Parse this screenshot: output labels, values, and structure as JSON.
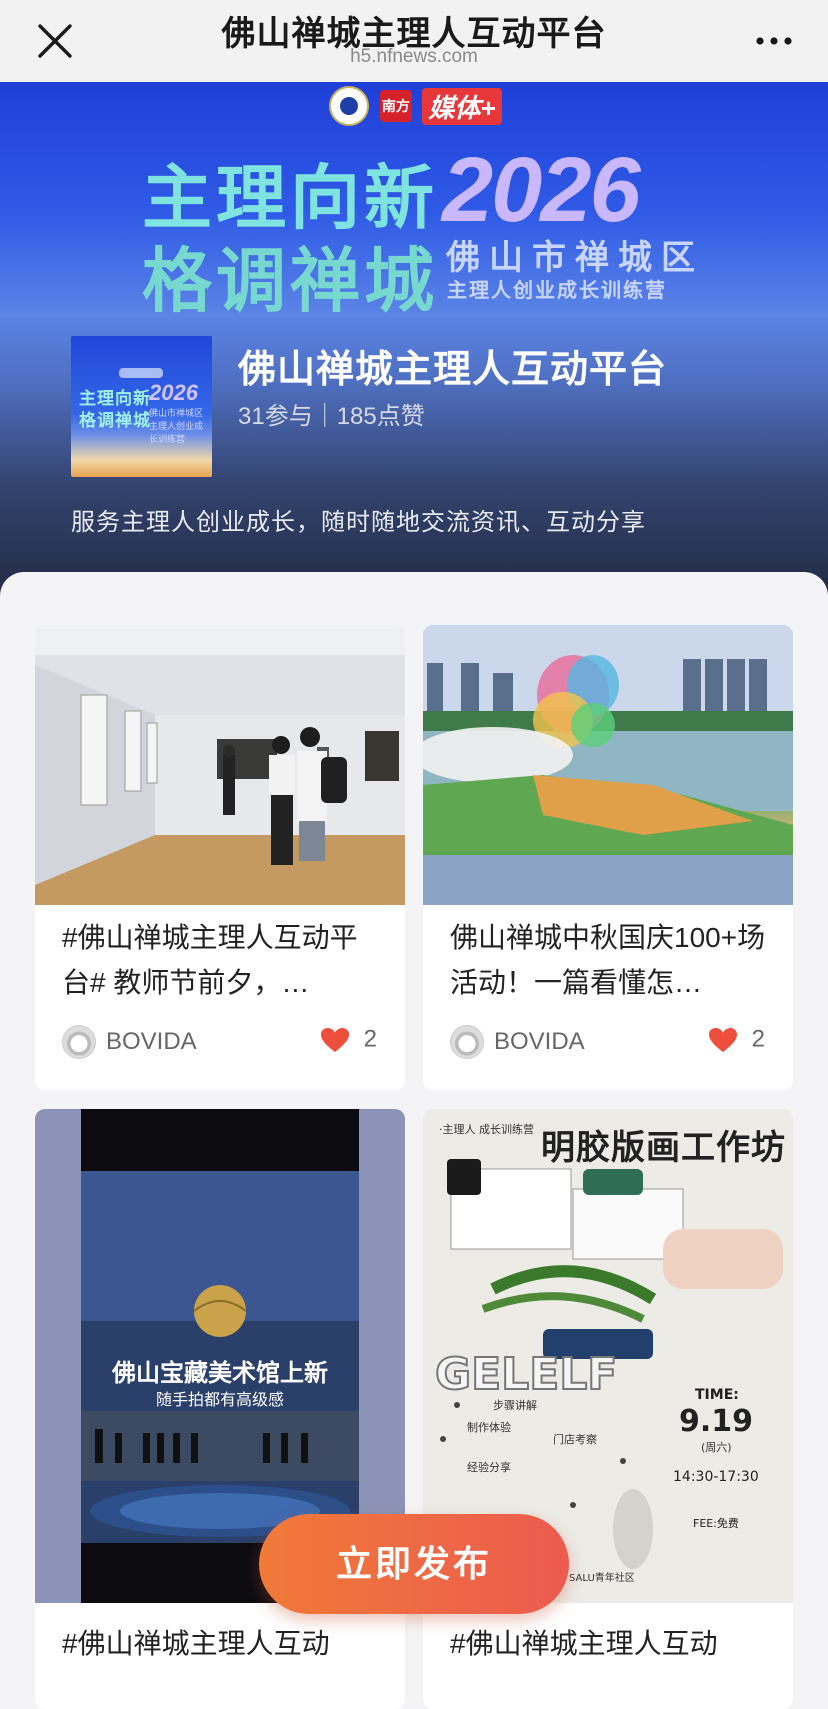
{
  "nav": {
    "title": "佛山禅城主理人互动平台",
    "url": "h5.nfnews.com"
  },
  "hero": {
    "logo_text": "媒体+",
    "logo_red": "南方",
    "slogan_line1": "主理向新",
    "slogan_line2": "格调禅城",
    "year": "2026",
    "camp_line1": "佛山市禅城区",
    "camp_line2": "主理人创业成长训练营",
    "cover": {
      "line1": "主理向新",
      "line2": "格调禅城",
      "year": "2026",
      "caption": "佛山市禅城区 主理人创业成长训练营"
    },
    "title": "佛山禅城主理人互动平台",
    "stats": "31参与｜185点赞",
    "description": "服务主理人创业成长，随时随地交流资讯、互动分享"
  },
  "feed": {
    "cards": [
      {
        "title": "#佛山禅城主理人互动平台# 教师节前夕，…",
        "author": "BOVIDA",
        "likes": "2",
        "image": "gallery-photo"
      },
      {
        "title": "佛山禅城中秋国庆100+场活动！一篇看懂怎…",
        "author": "BOVIDA",
        "likes": "2",
        "image": "dragon-boat-photo"
      },
      {
        "title": "#佛山禅城主理人互动",
        "image": "museum-photo",
        "overlay_line1": "佛山宝藏美术馆上新",
        "overlay_line2": "随手拍都有高级感"
      },
      {
        "title": "#佛山禅城主理人互动",
        "image": "workshop-poster",
        "poster": {
          "tag": "·主理人 成长训练营",
          "headline": "明胶版画工作坊",
          "brand": "GELELF",
          "time_label": "TIME:",
          "date": "9.19",
          "weekday": "(周六)",
          "hours": "14:30-17:30",
          "fee": "FEE:免费",
          "items": [
            "步骤讲解",
            "制作体验",
            "门店考察",
            "经验分享"
          ],
          "venue": "SALU青年社区"
        }
      }
    ]
  },
  "publish_button": "立即发布",
  "colors": {
    "accent": "#ef6a45",
    "heart": "#ee4e3c"
  }
}
